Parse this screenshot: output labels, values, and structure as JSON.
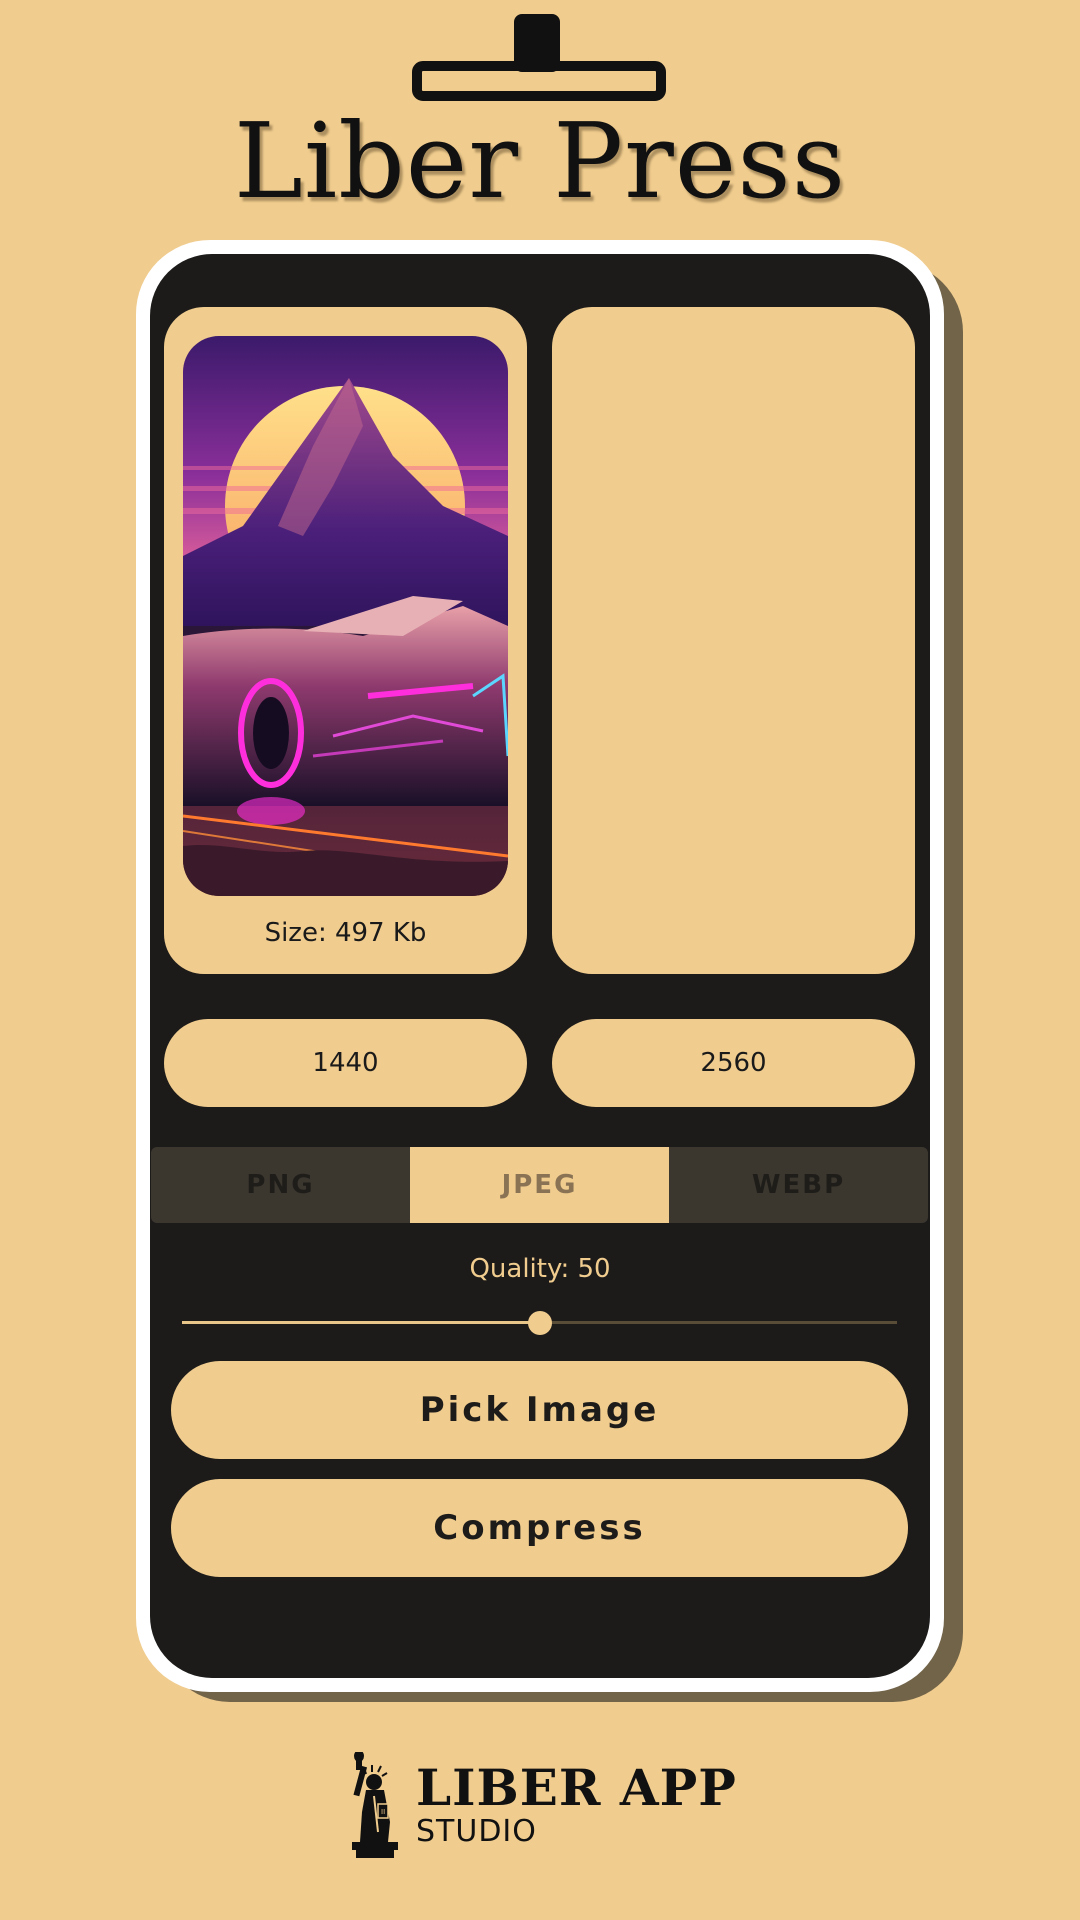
{
  "app": {
    "title": "Liber Press"
  },
  "preview": {
    "original_size": "Size: 497 Kb"
  },
  "dimensions": {
    "width": "1440",
    "height": "2560"
  },
  "formats": {
    "options": [
      "PNG",
      "JPEG",
      "WEBP"
    ],
    "selected": "JPEG"
  },
  "quality": {
    "label": "Quality: 50",
    "value": 50,
    "max": 100
  },
  "actions": {
    "pick_label": "Pick Image",
    "compress_label": "Compress"
  },
  "footer": {
    "brand": "LIBER APP",
    "sub": "STUDIO"
  },
  "icons": {
    "header": "press-icon",
    "footer": "statue-of-liberty-icon"
  },
  "colors": {
    "background": "#F0CC8E",
    "screen": "#1C1B1A",
    "accent": "#F0CC8E"
  }
}
